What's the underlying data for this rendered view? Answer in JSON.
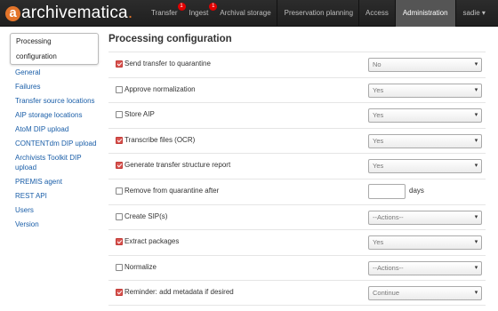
{
  "brand": {
    "name": "archivematica",
    "initial": "a"
  },
  "nav": [
    {
      "label": "Transfer",
      "badge": "1"
    },
    {
      "label": "Ingest",
      "badge": "1"
    },
    {
      "label": "Archival storage"
    },
    {
      "label": "Preservation planning"
    },
    {
      "label": "Access"
    },
    {
      "label": "Administration",
      "active": true
    },
    {
      "label": "sadie ▾"
    }
  ],
  "sidebar": {
    "items": [
      {
        "label": "Processing configuration",
        "active": true
      },
      {
        "label": "General"
      },
      {
        "label": "Failures"
      },
      {
        "label": "Transfer source locations"
      },
      {
        "label": "AIP storage locations"
      },
      {
        "label": "AtoM DIP upload"
      },
      {
        "label": "CONTENTdm DIP upload"
      },
      {
        "label": "Archivists Toolkit DIP upload"
      },
      {
        "label": "PREMIS agent"
      },
      {
        "label": "REST API"
      },
      {
        "label": "Users"
      },
      {
        "label": "Version"
      }
    ]
  },
  "main": {
    "title": "Processing configuration",
    "rows": [
      {
        "label": "Send transfer to quarantine",
        "checked": true,
        "value": "No"
      },
      {
        "label": "Approve normalization",
        "checked": false,
        "value": "Yes"
      },
      {
        "label": "Store AIP",
        "checked": false,
        "value": "Yes"
      },
      {
        "label": "Transcribe files (OCR)",
        "checked": true,
        "value": "Yes"
      },
      {
        "label": "Generate transfer structure report",
        "checked": true,
        "value": "Yes"
      },
      {
        "label": "Remove from quarantine after",
        "checked": false,
        "input": "",
        "unit": "days"
      },
      {
        "label": "Create SIP(s)",
        "checked": false,
        "value": "--Actions--"
      },
      {
        "label": "Extract packages",
        "checked": true,
        "value": "Yes"
      },
      {
        "label": "Normalize",
        "checked": false,
        "value": "--Actions--"
      },
      {
        "label": "Reminder: add metadata if desired",
        "checked": true,
        "value": "Continue"
      }
    ]
  }
}
